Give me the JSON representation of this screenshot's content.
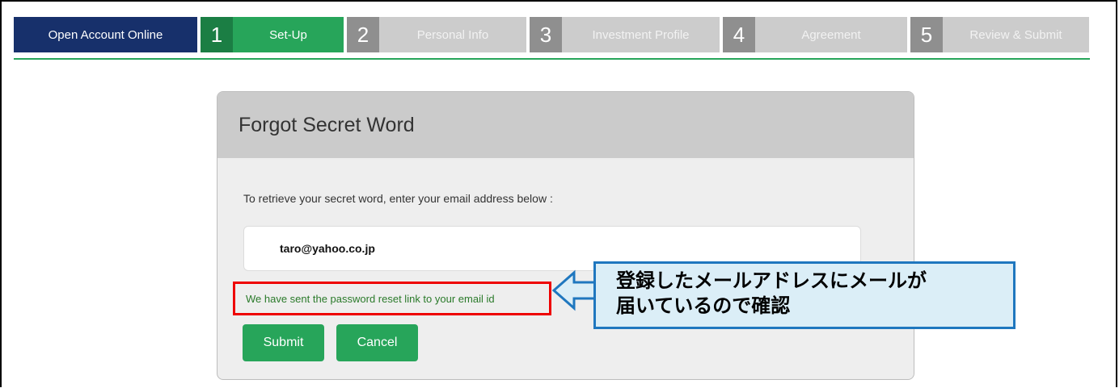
{
  "steps": {
    "open_label": "Open Account Online",
    "items": [
      {
        "num": "1",
        "label": "Set-Up"
      },
      {
        "num": "2",
        "label": "Personal Info"
      },
      {
        "num": "3",
        "label": "Investment Profile"
      },
      {
        "num": "4",
        "label": "Agreement"
      },
      {
        "num": "5",
        "label": "Review & Submit"
      }
    ]
  },
  "panel": {
    "title": "Forgot Secret Word",
    "instruction": "To retrieve your secret word, enter your email address below :",
    "email_value": "taro@yahoo.co.jp",
    "message": "We have sent the password reset link to your email id",
    "submit_label": "Submit",
    "cancel_label": "Cancel"
  },
  "callout": {
    "line1": "登録したメールアドレスにメールが",
    "line2": "届いているので確認"
  },
  "colors": {
    "brand_navy": "#17306b",
    "active_green": "#27a55a",
    "highlight_red": "#ee0000",
    "callout_blue": "#1f77bf"
  }
}
